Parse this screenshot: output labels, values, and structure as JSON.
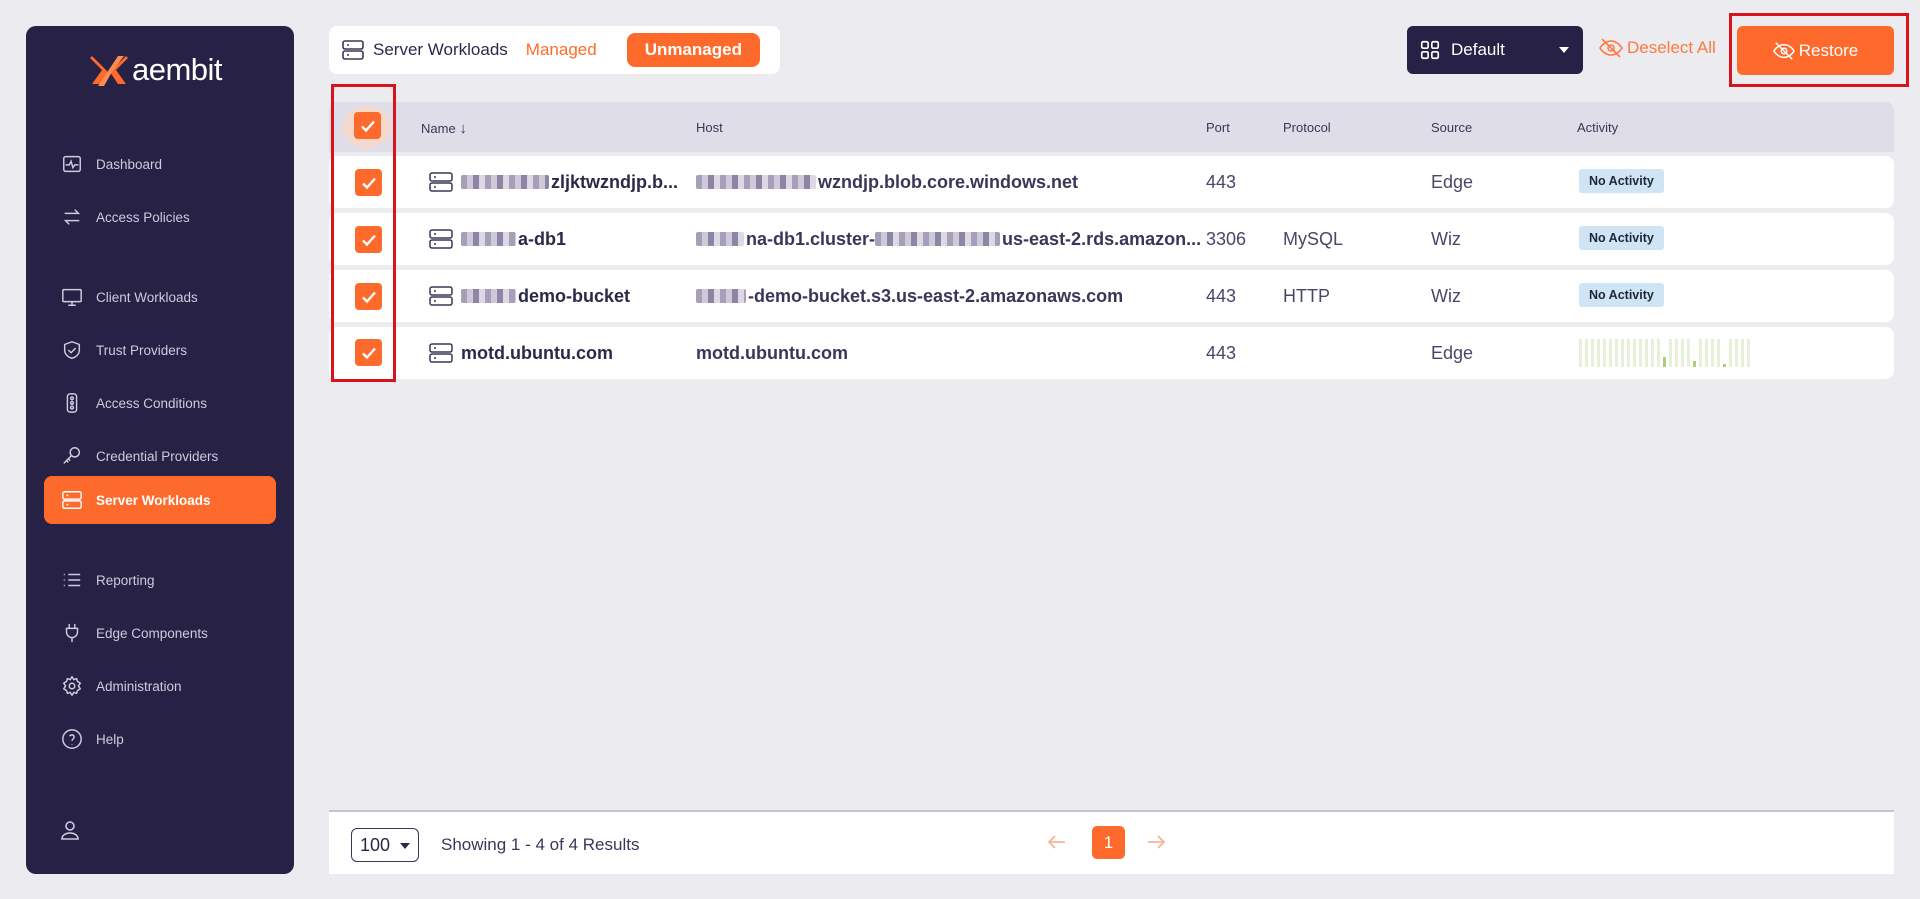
{
  "brand": {
    "name": "aembit",
    "accent": "#fe6a2b",
    "sidebar_bg": "#262145"
  },
  "sidebar": {
    "items": [
      {
        "label": "Dashboard",
        "icon": "activity-icon"
      },
      {
        "label": "Access Policies",
        "icon": "arrows-swap-icon"
      },
      {
        "label": "Client Workloads",
        "icon": "monitor-icon"
      },
      {
        "label": "Trust Providers",
        "icon": "shield-check-icon"
      },
      {
        "label": "Access Conditions",
        "icon": "traffic-light-icon"
      },
      {
        "label": "Credential Providers",
        "icon": "key-icon"
      },
      {
        "label": "Server Workloads",
        "icon": "server-icon",
        "active": true
      },
      {
        "label": "Reporting",
        "icon": "list-icon"
      },
      {
        "label": "Edge Components",
        "icon": "plug-icon"
      },
      {
        "label": "Administration",
        "icon": "gear-icon"
      },
      {
        "label": "Help",
        "icon": "help-circle-icon"
      }
    ],
    "user_icon": "user-icon"
  },
  "header": {
    "title": "Server Workloads",
    "tabs": [
      {
        "label": "Managed"
      },
      {
        "label": "Unmanaged",
        "active": true
      }
    ],
    "view_select": "Default",
    "deselect_label": "Deselect All",
    "restore_label": "Restore"
  },
  "table": {
    "columns": [
      "Name",
      "Host",
      "Port",
      "Protocol",
      "Source",
      "Activity"
    ],
    "rows": [
      {
        "name": "zljktwzndjp.b...",
        "host": "wzndjp.blob.core.windows.net",
        "port": "443",
        "protocol": "",
        "source": "Edge",
        "activity": "No Activity",
        "checked": true
      },
      {
        "name": "a-db1",
        "host_a": "na-db1.cluster-",
        "host_b": "us-east-2.rds.amazon...",
        "port": "3306",
        "protocol": "MySQL",
        "source": "Wiz",
        "activity": "No Activity",
        "checked": true
      },
      {
        "name": "demo-bucket",
        "host": "-demo-bucket.s3.us-east-2.amazonaws.com",
        "port": "443",
        "protocol": "HTTP",
        "source": "Wiz",
        "activity": "No Activity",
        "checked": true
      },
      {
        "name": "motd.ubuntu.com",
        "host": "motd.ubuntu.com",
        "port": "443",
        "protocol": "",
        "source": "Edge",
        "activity": "",
        "checked": true
      }
    ]
  },
  "footer": {
    "per_page": "100",
    "results_text": "Showing 1 - 4 of 4 Results",
    "current_page": "1"
  }
}
